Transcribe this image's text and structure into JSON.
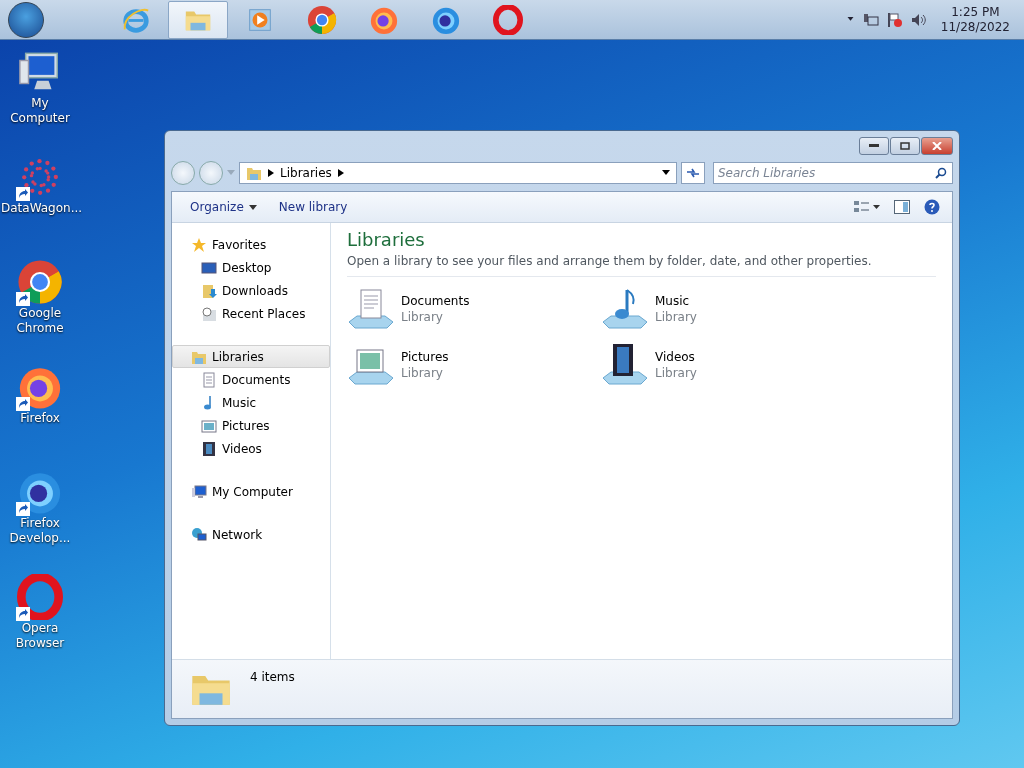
{
  "taskbar": {
    "apps": [
      {
        "kind": "ie",
        "selected": false
      },
      {
        "kind": "explorer",
        "selected": true
      },
      {
        "kind": "media",
        "selected": false
      },
      {
        "kind": "chrome",
        "selected": false
      },
      {
        "kind": "firefox",
        "selected": false
      },
      {
        "kind": "firefox-dev",
        "selected": false
      },
      {
        "kind": "opera",
        "selected": false
      }
    ],
    "clock": {
      "time": "1:25 PM",
      "date": "11/28/2022"
    }
  },
  "desktop_icons": [
    {
      "label": "My Computer",
      "kind": "computer",
      "shortcut": false
    },
    {
      "label": "DataWagon...",
      "kind": "datawagon",
      "shortcut": true
    },
    {
      "label": "Google Chrome",
      "kind": "chrome",
      "shortcut": true
    },
    {
      "label": "Firefox",
      "kind": "firefox",
      "shortcut": true
    },
    {
      "label": "Firefox Develop...",
      "kind": "firefox-dev",
      "shortcut": true
    },
    {
      "label": "Opera Browser",
      "kind": "opera",
      "shortcut": true
    }
  ],
  "window": {
    "address": {
      "crumbs": [
        "Libraries"
      ]
    },
    "search": {
      "placeholder": "Search Libraries"
    },
    "toolbar": [
      {
        "label": "Organize",
        "dropdown": true
      },
      {
        "label": "New library",
        "dropdown": false
      }
    ],
    "nav": [
      {
        "label": "Favorites",
        "kind": "star",
        "selected": false,
        "children": [
          {
            "label": "Desktop",
            "kind": "desktop",
            "selected": false
          },
          {
            "label": "Downloads",
            "kind": "downloads",
            "selected": false
          },
          {
            "label": "Recent Places",
            "kind": "recent",
            "selected": false
          }
        ]
      },
      {
        "label": "Libraries",
        "kind": "libraries",
        "selected": true,
        "children": [
          {
            "label": "Documents",
            "kind": "documents",
            "selected": false
          },
          {
            "label": "Music",
            "kind": "music",
            "selected": false
          },
          {
            "label": "Pictures",
            "kind": "pictures",
            "selected": false
          },
          {
            "label": "Videos",
            "kind": "videos",
            "selected": false
          }
        ]
      },
      {
        "label": "My Computer",
        "kind": "computer",
        "selected": false
      },
      {
        "label": "Network",
        "kind": "network",
        "selected": false
      }
    ],
    "content": {
      "title": "Libraries",
      "subtitle": "Open a library to see your files and arrange them by folder, date, and other properties.",
      "items": [
        {
          "name": "Documents",
          "type": "Library",
          "kind": "documents"
        },
        {
          "name": "Music",
          "type": "Library",
          "kind": "music"
        },
        {
          "name": "Pictures",
          "type": "Library",
          "kind": "pictures"
        },
        {
          "name": "Videos",
          "type": "Library",
          "kind": "videos"
        }
      ]
    },
    "status": "4 items"
  }
}
